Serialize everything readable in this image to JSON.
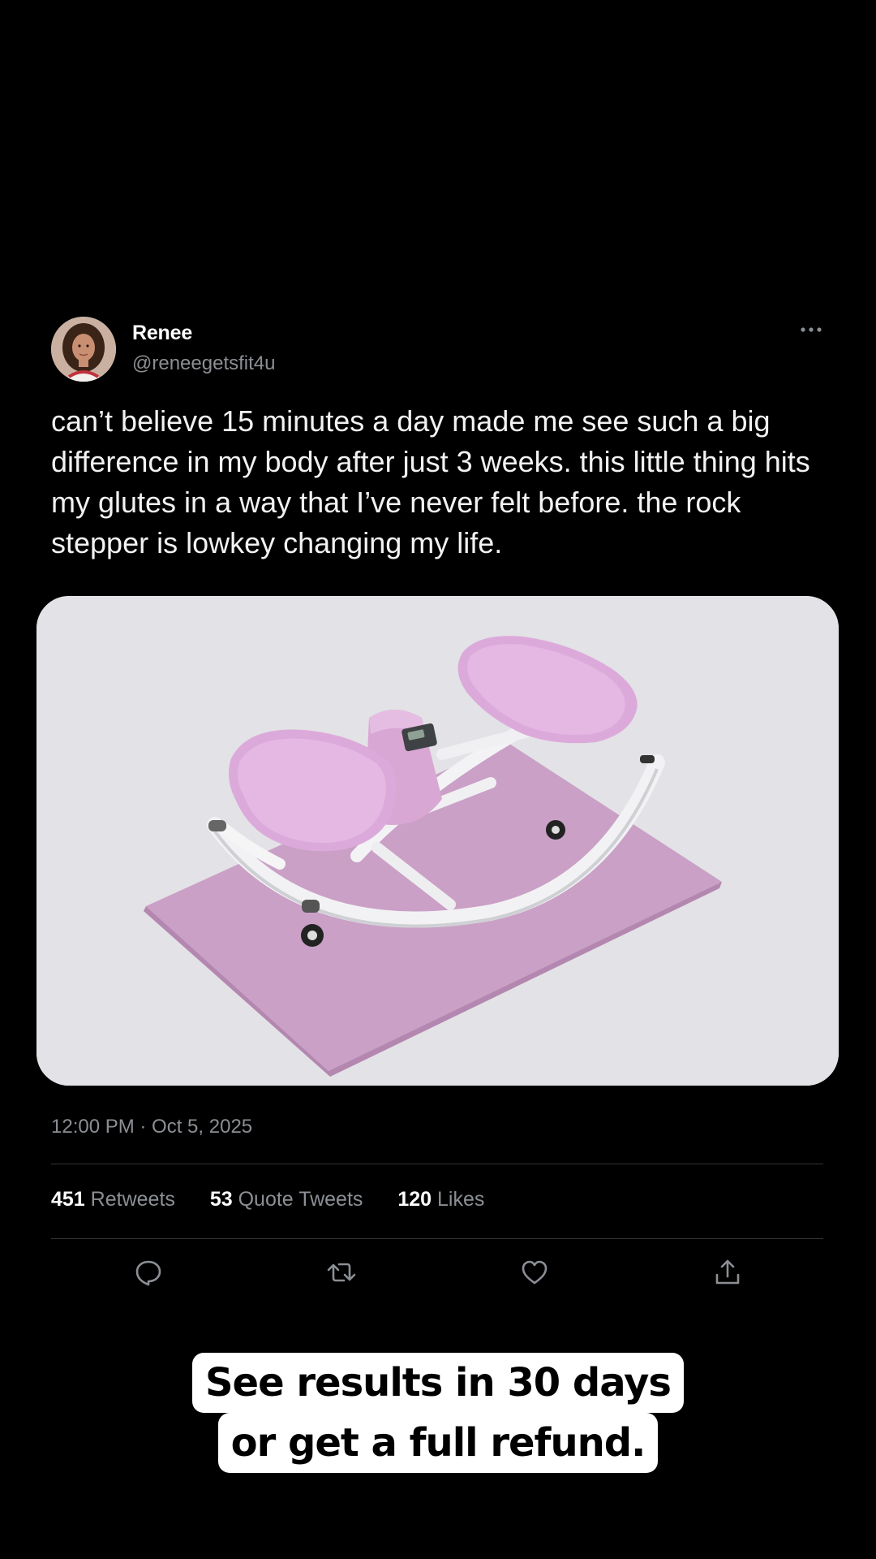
{
  "user": {
    "display_name": "Renee",
    "handle": "@reneegetsfit4u"
  },
  "tweet": {
    "text": "can’t believe 15 minutes a day made me see such a big difference in my body after just 3 weeks. this little thing hits my glutes in a way that I’ve never felt before. the rock stepper is lowkey changing my life.",
    "timestamp": "12:00 PM · Oct 5, 2025"
  },
  "stats": {
    "retweets_count": "451",
    "retweets_label": "Retweets",
    "quote_count": "53",
    "quote_label": "Quote Tweets",
    "likes_count": "120",
    "likes_label": "Likes"
  },
  "actions": {
    "icons": [
      "reply-icon",
      "retweet-icon",
      "like-icon",
      "share-icon"
    ]
  },
  "caption": {
    "line1": "See results in 30 days",
    "line2": "or get a full refund."
  },
  "colors": {
    "background": "#000000",
    "text_primary": "#ffffff",
    "text_secondary": "#8b8f94",
    "divider": "#333639",
    "media_background": "#e3e2e6",
    "product_pink": "#d9aad8",
    "caption_background": "#ffffff"
  }
}
